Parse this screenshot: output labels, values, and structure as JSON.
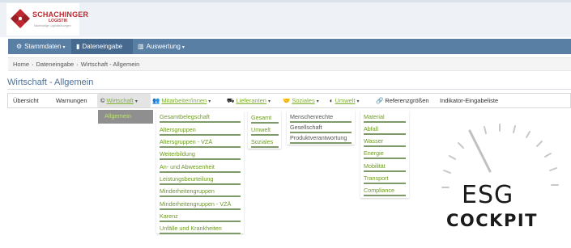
{
  "logo": {
    "name": "SCHACHINGER",
    "sub": "LOGISTIK",
    "tagline": "Nachhaltige Logistiklösungen"
  },
  "navbar": {
    "items": [
      {
        "label": "Stammdaten",
        "icon": "gears-icon"
      },
      {
        "label": "Dateneingabe",
        "icon": "document-icon"
      },
      {
        "label": "Auswertung",
        "icon": "bar-chart-icon"
      }
    ]
  },
  "breadcrumb": [
    "Home",
    "Dateneingabe",
    "Wirtschaft - Allgemein"
  ],
  "page_title": "Wirtschaft - Allgemein",
  "tabs": [
    {
      "label": "Übersicht"
    },
    {
      "label": "Warnungen"
    },
    {
      "label": "Wirtschaft",
      "icon": "copyright-icon"
    },
    {
      "label": "Mitarbeiter/innen",
      "icon": "users-icon"
    },
    {
      "label": "Lieferanten",
      "icon": "truck-icon"
    },
    {
      "label": "Soziales",
      "icon": "handshake-icon"
    },
    {
      "label": "Umwelt",
      "icon": "globe-icon"
    },
    {
      "label": "Referenzgrößen",
      "icon": "link-icon"
    },
    {
      "label": "Indikator-Eingabeliste"
    }
  ],
  "menus": {
    "wirtschaft": [
      "Allgemein"
    ],
    "mitarbeiter": [
      "Gesamtbelegschaft",
      "Altersgruppen",
      "Altersgruppen - VZÄ",
      "Weiterbildung",
      "An- und Abwesenheit",
      "Leistungsbeurteilung",
      "Minderheitengruppen",
      "Minderheitengruppen - VZÄ",
      "Karenz",
      "Unfälle und Krankheiten"
    ],
    "lieferanten": [
      "Gesamt",
      "Umwelt",
      "Soziales"
    ],
    "soziales": [
      "Menschenrechte",
      "Gesellschaft",
      "Produktverantwortung"
    ],
    "umwelt": [
      "Material",
      "Abfall",
      "Wasser",
      "Energie",
      "Mobilität",
      "Transport",
      "Compliance"
    ]
  },
  "branding": {
    "esg": "ESG",
    "cockpit": "COCKPIT"
  },
  "colors": {
    "navbar": "#5a7fa4",
    "menu_text": "#6f9a23",
    "brand_red": "#c0262d",
    "title": "#4d6f94"
  }
}
